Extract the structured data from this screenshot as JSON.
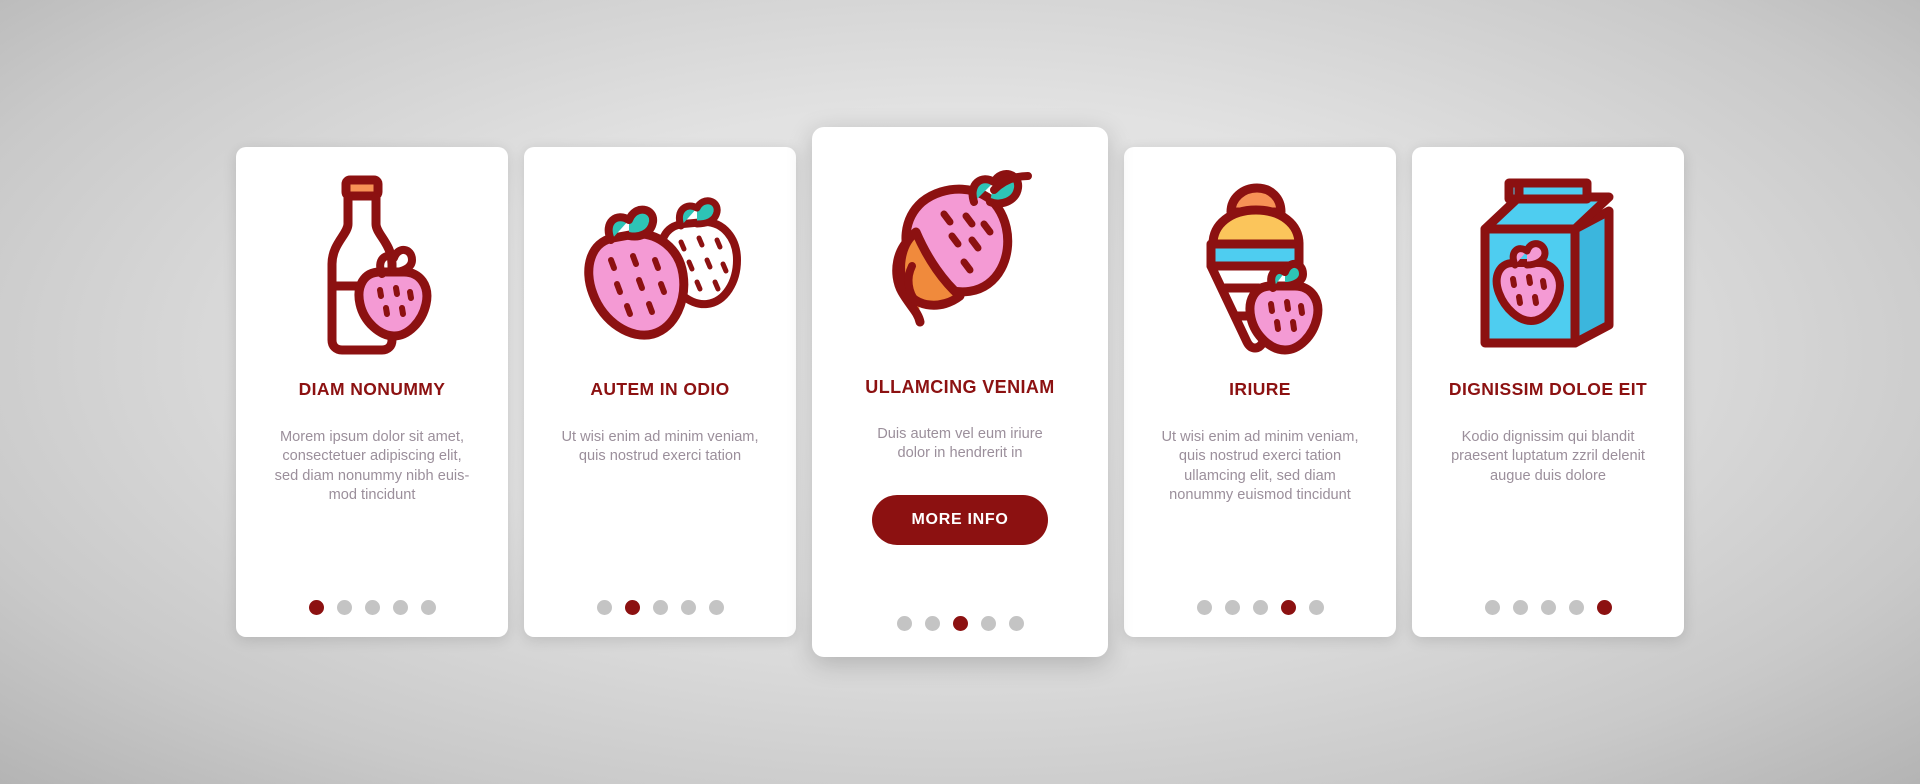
{
  "background": {
    "color_center": "#e9e9e9",
    "color_edge": "#b4b4b4"
  },
  "theme": {
    "accent_dark_red": "#8c1111",
    "body_text": "#9b8f9b",
    "dot_inactive": "#c4c4c4",
    "dot_active": "#8c1111",
    "card_background": "#ffffff",
    "strawberry_pink": "#f49ad4",
    "leaf_teal": "#2ec4b6",
    "cap_orange": "#f79256",
    "scoop_orange": "#f79256",
    "scoop_yellow": "#fbc55b",
    "carton_cyan": "#4ecdf0",
    "carton_cyan_dark": "#3bb6dd"
  },
  "cards": [
    {
      "icon": "soda-bottle-strawberry-icon",
      "title": "DIAM NONUMMY",
      "body": "Morem ipsum dolor sit amet, consectetuer adipiscing elit, sed diam nonummy nibh euis-mod tincidunt",
      "featured": false,
      "dots": {
        "count": 5,
        "active_index": 0
      }
    },
    {
      "icon": "two-strawberries-icon",
      "title": "AUTEM IN ODIO",
      "body": "Ut wisi enim ad minim veniam, quis nostrud exerci tation",
      "featured": false,
      "dots": {
        "count": 5,
        "active_index": 1
      }
    },
    {
      "icon": "chocolate-dipped-strawberry-icon",
      "title": "ULLAMCING VENIAM",
      "body": "Duis autem vel eum iriure dolor in hendrerit in",
      "button_label": "MORE INFO",
      "featured": true,
      "dots": {
        "count": 5,
        "active_index": 2
      }
    },
    {
      "icon": "ice-cream-cone-strawberry-icon",
      "title": "IRIURE",
      "body": "Ut wisi enim ad minim veniam, quis nostrud exerci tation ullamcing elit, sed diam nonummy euismod tincidunt",
      "featured": false,
      "dots": {
        "count": 5,
        "active_index": 3
      }
    },
    {
      "icon": "milk-carton-strawberry-icon",
      "title": "DIGNISSIM DOLOE EIT",
      "body": "Kodio dignissim qui blandit praesent luptatum zzril delenit augue duis dolore",
      "featured": false,
      "dots": {
        "count": 5,
        "active_index": 4
      }
    }
  ]
}
